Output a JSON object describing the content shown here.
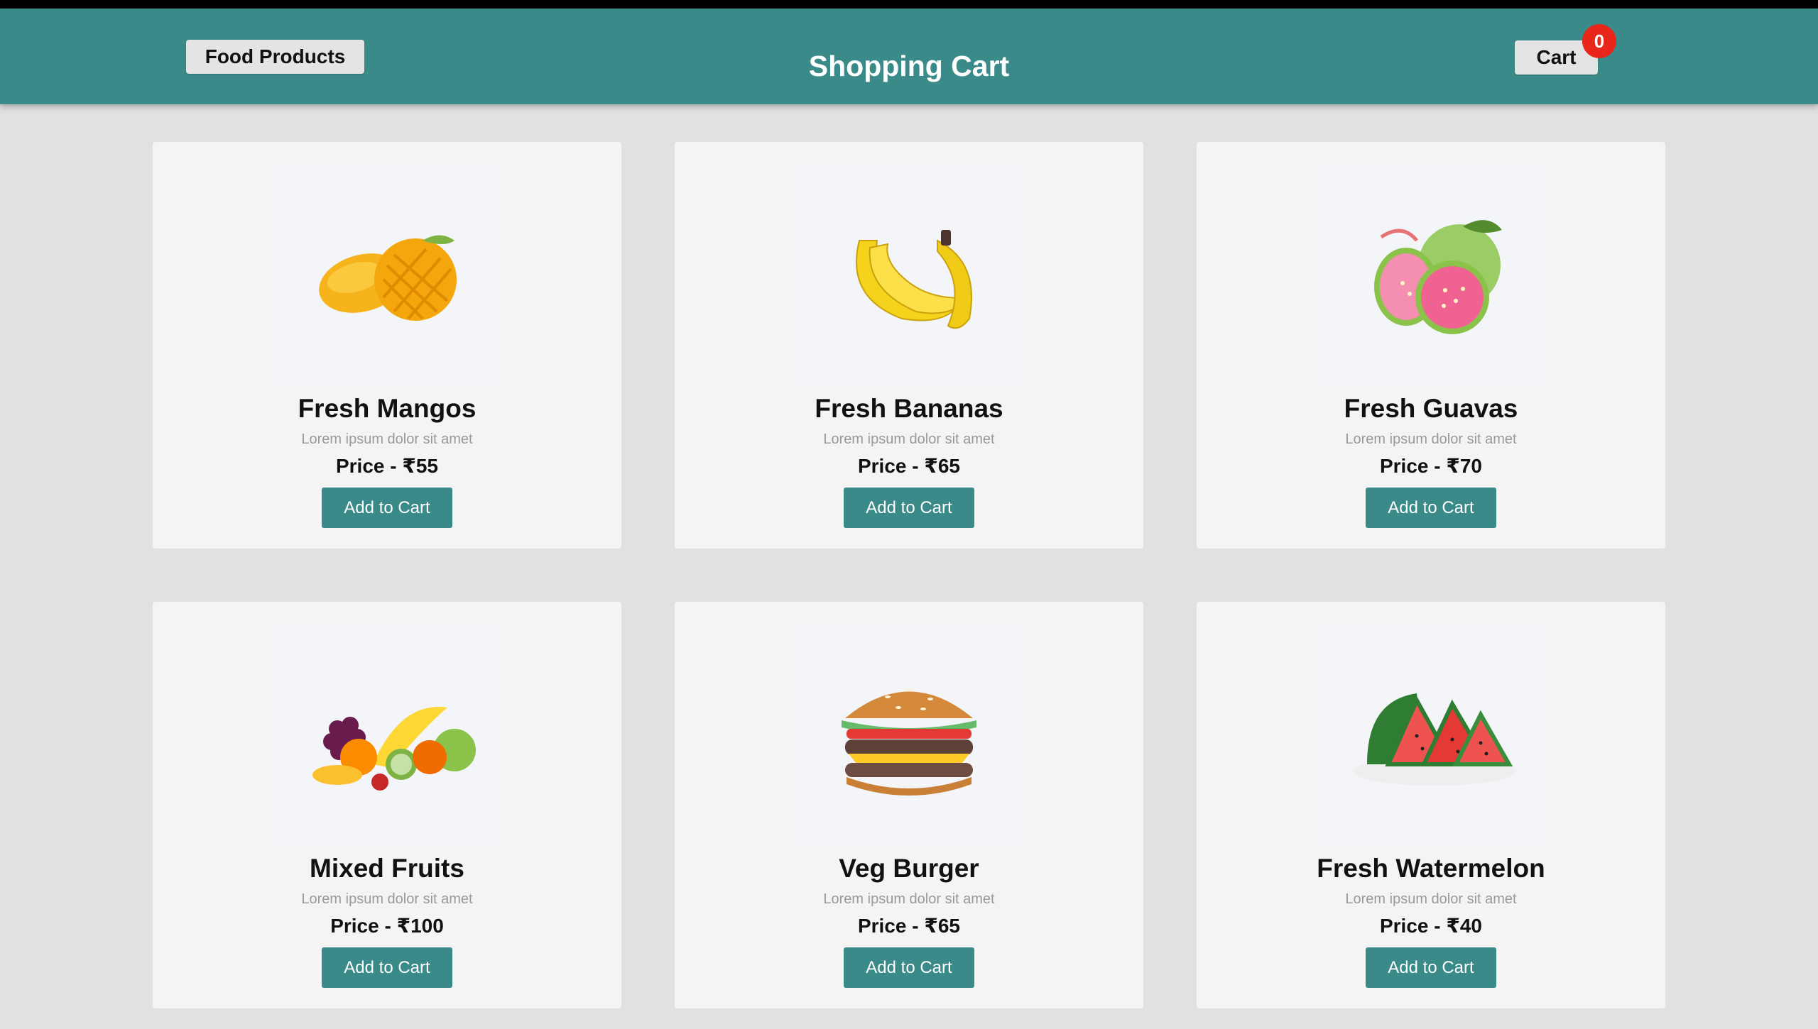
{
  "navbar": {
    "brand_label": "Food Products",
    "title": "Shopping Cart",
    "cart_label": "Cart",
    "cart_count": "0",
    "bg_color": "#3b8a8a",
    "badge_color": "#e8261a"
  },
  "products": [
    {
      "name": "Fresh Mangos",
      "description": "Lorem ipsum dolor sit amet",
      "price": "Price - ₹55",
      "button_label": "Add to Cart",
      "image_icon": "mango-image"
    },
    {
      "name": "Fresh Bananas",
      "description": "Lorem ipsum dolor sit amet",
      "price": "Price - ₹65",
      "button_label": "Add to Cart",
      "image_icon": "banana-image"
    },
    {
      "name": "Fresh Guavas",
      "description": "Lorem ipsum dolor sit amet",
      "price": "Price - ₹70",
      "button_label": "Add to Cart",
      "image_icon": "guava-image"
    },
    {
      "name": "Mixed Fruits",
      "description": "Lorem ipsum dolor sit amet",
      "price": "Price - ₹100",
      "button_label": "Add to Cart",
      "image_icon": "mixed-fruits-image"
    },
    {
      "name": "Veg Burger",
      "description": "Lorem ipsum dolor sit amet",
      "price": "Price - ₹65",
      "button_label": "Add to Cart",
      "image_icon": "burger-image"
    },
    {
      "name": "Fresh Watermelon",
      "description": "Lorem ipsum dolor sit amet",
      "price": "Price - ₹40",
      "button_label": "Add to Cart",
      "image_icon": "watermelon-image"
    }
  ]
}
